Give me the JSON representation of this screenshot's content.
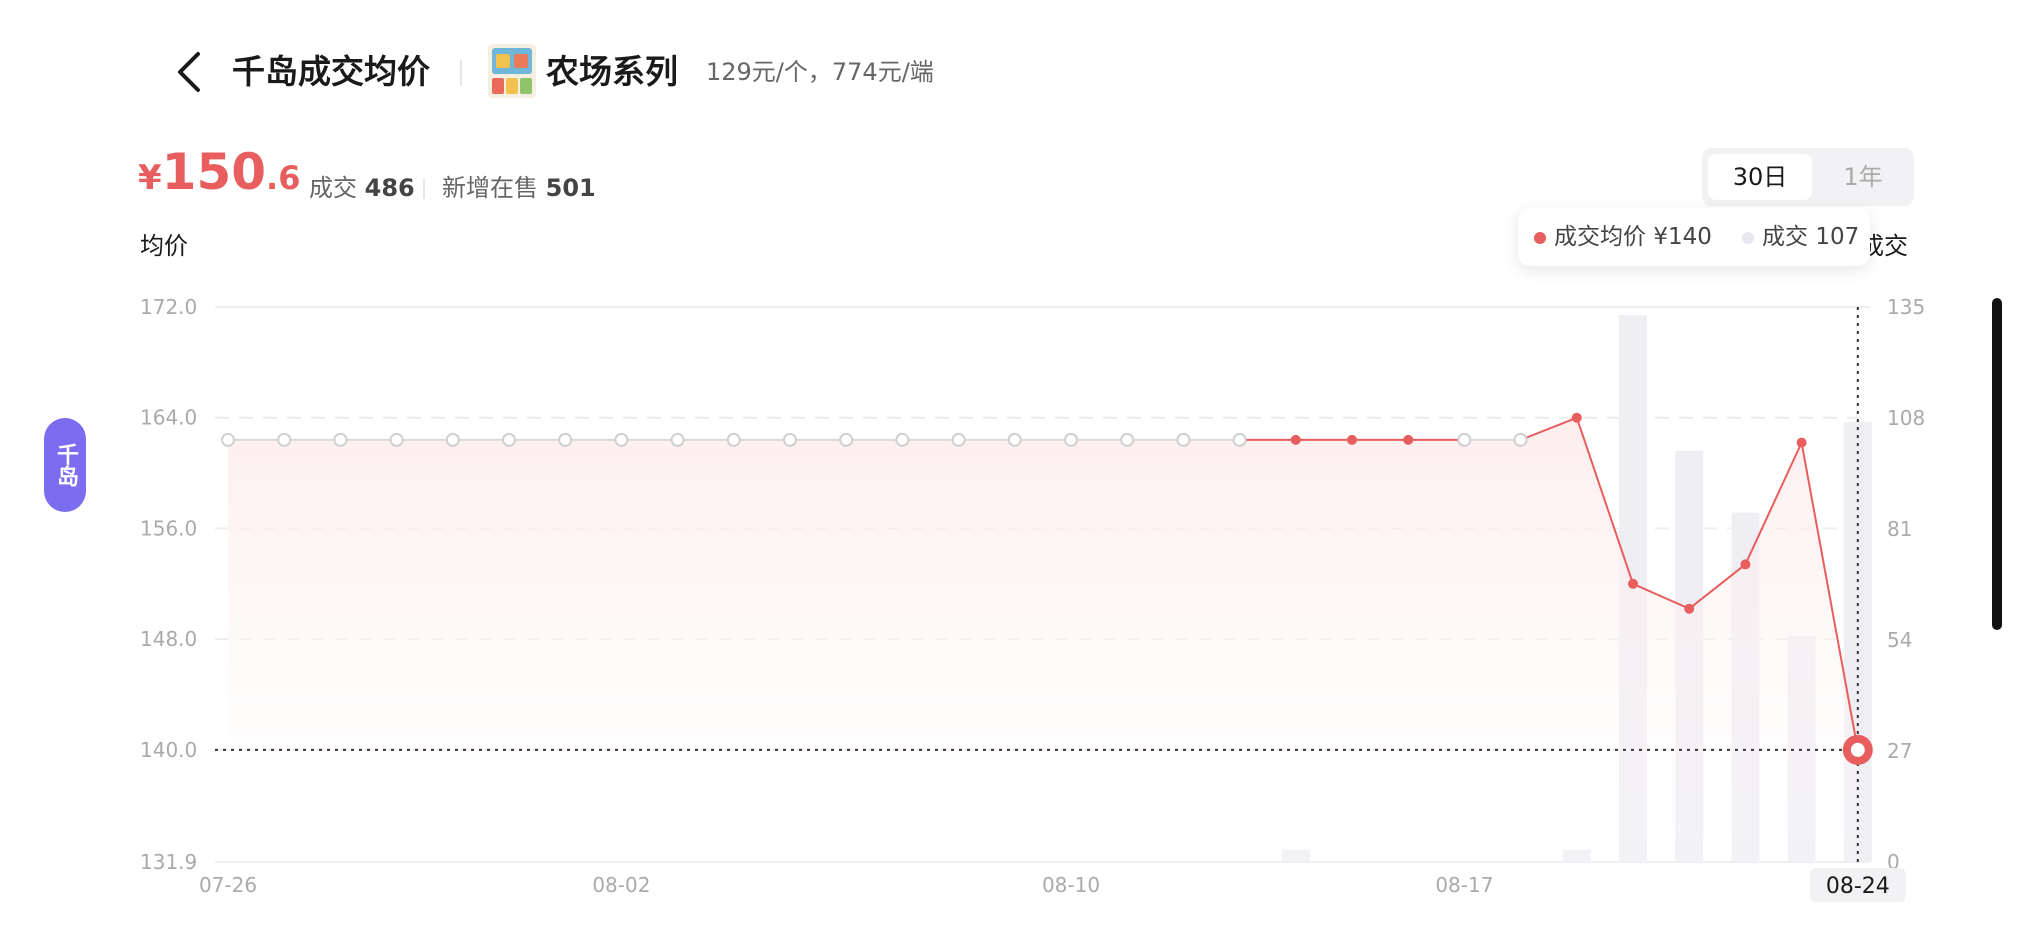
{
  "header": {
    "back_icon": "chevron-left-icon",
    "title": "千岛成交均价",
    "series_name": "农场系列",
    "series_price": "129元/个，774元/端"
  },
  "summary": {
    "price_symbol": "¥",
    "price_int": "150",
    "price_dec": ".6",
    "deal_label": "成交",
    "deal_count": "486",
    "new_label": "新增在售",
    "new_count": "501"
  },
  "range_tabs": [
    {
      "label": "30日",
      "active": true
    },
    {
      "label": "1年",
      "active": false
    }
  ],
  "tooltip": {
    "avg_label": "成交均价",
    "avg_value": "¥140",
    "deal_label": "成交",
    "deal_value": "107"
  },
  "side_badge": "千岛",
  "colors": {
    "accent": "#e85d5d",
    "bar": "#efeef3",
    "badge": "#7b6cf0"
  },
  "chart_data": {
    "type": "line",
    "ylabel": "均价",
    "y2label": "成交",
    "x_tick_labels": [
      "07-26",
      "08-02",
      "08-10",
      "08-17",
      "08-24"
    ],
    "selected_x_label": "08-24",
    "ylim": [
      131.9,
      172.0
    ],
    "y_ticks": [
      "172.0",
      "164.0",
      "156.0",
      "148.0",
      "140.0",
      "131.9"
    ],
    "y2lim": [
      0,
      135
    ],
    "y2_ticks": [
      "135",
      "108",
      "81",
      "54",
      "27",
      "0"
    ],
    "reference_line": 140.0,
    "series": [
      {
        "kind": "line",
        "axis": "left",
        "values": [
          162.4,
          162.4,
          162.4,
          162.4,
          162.4,
          162.4,
          162.4,
          162.4,
          162.4,
          162.4,
          162.4,
          162.4,
          162.4,
          162.4,
          162.4,
          162.4,
          162.4,
          162.4,
          162.4,
          162.4,
          162.4,
          162.4,
          162.4,
          162.4,
          164.0,
          152.0,
          150.2,
          153.4,
          162.2,
          140.0
        ],
        "observed": [
          false,
          false,
          false,
          false,
          false,
          false,
          false,
          false,
          false,
          false,
          false,
          false,
          false,
          false,
          false,
          false,
          false,
          false,
          false,
          true,
          true,
          true,
          false,
          false,
          true,
          true,
          true,
          true,
          true,
          true
        ]
      },
      {
        "kind": "bar",
        "axis": "right",
        "values": [
          0,
          0,
          0,
          0,
          0,
          0,
          0,
          0,
          0,
          0,
          0,
          0,
          0,
          0,
          0,
          0,
          0,
          0,
          0,
          3,
          0,
          0,
          0,
          0,
          3,
          133,
          100,
          85,
          55,
          107
        ]
      }
    ]
  }
}
